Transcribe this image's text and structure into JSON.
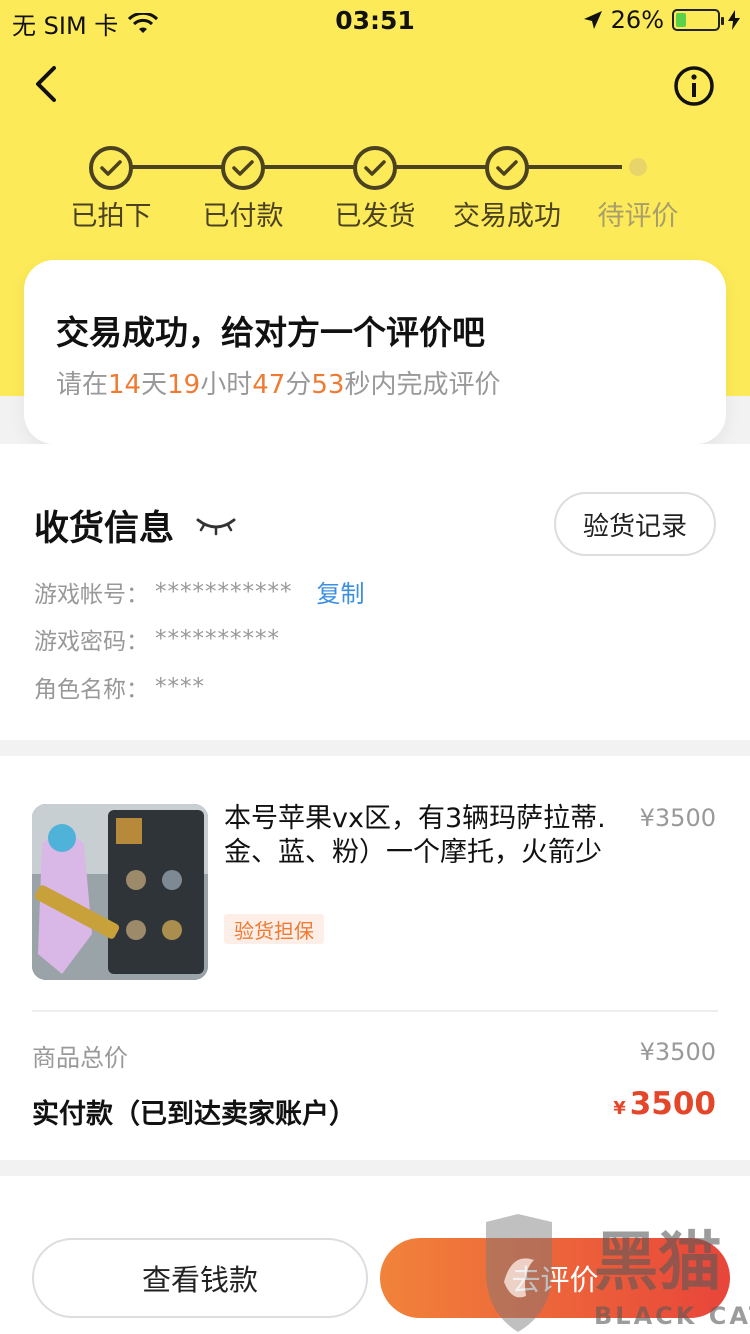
{
  "status_bar": {
    "carrier": "无 SIM 卡",
    "time": "03:51",
    "battery": "26%",
    "battery_level": 0.26
  },
  "nav": {
    "back_icon": "chevron-left-icon",
    "info_icon": "info-icon"
  },
  "steps": [
    {
      "label": "已拍下",
      "done": true
    },
    {
      "label": "已付款",
      "done": true
    },
    {
      "label": "已发货",
      "done": true
    },
    {
      "label": "交易成功",
      "done": true
    },
    {
      "label": "待评价",
      "done": false
    }
  ],
  "review_prompt": {
    "title": "交易成功，给对方一个评价吧",
    "prefix": "请在",
    "days": "14",
    "days_unit": "天",
    "hours": "19",
    "hours_unit": "小时",
    "minutes": "47",
    "minutes_unit": "分",
    "seconds": "53",
    "suffix": "秒内完成评价"
  },
  "receive_info": {
    "heading": "收货信息",
    "inspect_button": "验货记录",
    "rows": [
      {
        "label": "游戏帐号：",
        "value": "***********",
        "action": "复制"
      },
      {
        "label": "游戏密码：",
        "value": "**********"
      },
      {
        "label": "角色名称：",
        "value": "****"
      }
    ]
  },
  "order": {
    "product_title": "本号苹果vx区，有3辆玛萨拉蒂.金、蓝、粉）一个摩托，火箭少",
    "price": "¥3500",
    "tag": "验货担保",
    "total_label": "商品总价",
    "total_value": "¥3500",
    "paid_label": "实付款（已到达卖家账户）",
    "paid_currency": "¥",
    "paid_value": "3500"
  },
  "actions": {
    "wallet_button": "查看钱款",
    "review_button": "去评价"
  },
  "watermark": {
    "text": "黑猫",
    "subtext": "BLACK CAT"
  },
  "colors": {
    "brand_yellow": "#fdea58",
    "accent_orange": "#ef7b32",
    "price_red": "#e4462a",
    "link_blue": "#3b8fe0"
  }
}
